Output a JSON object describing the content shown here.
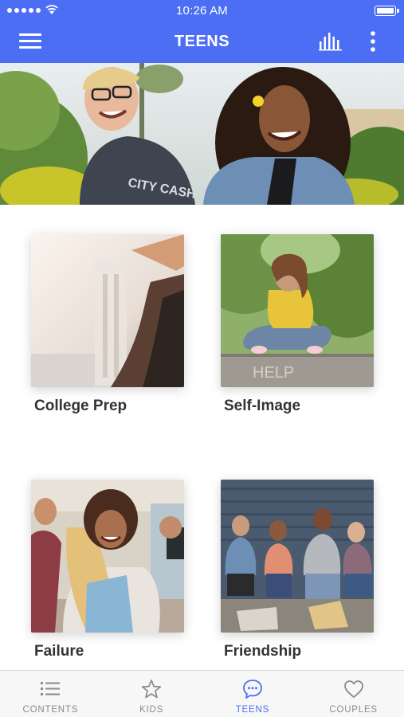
{
  "status_bar": {
    "time": "10:26 AM"
  },
  "header": {
    "title": "TEENS",
    "menu_icon": "hamburger-icon",
    "stats_icon": "bar-chart-icon",
    "more_icon": "more-vertical-icon"
  },
  "colors": {
    "primary": "#4c6ef5",
    "inactive": "#8a8a8a",
    "label": "#333333"
  },
  "hero": {
    "image": "two-smiling-teens-photo"
  },
  "topics": [
    {
      "label": "College Prep",
      "image": "graduation-cap-photo"
    },
    {
      "label": "Self-Image",
      "image": "girl-sitting-help-photo"
    },
    {
      "label": "Failure",
      "image": "friends-hug-hallway-photo"
    },
    {
      "label": "Friendship",
      "image": "group-of-teens-photo"
    }
  ],
  "tabs": [
    {
      "label": "CONTENTS",
      "icon": "list-icon",
      "active": false
    },
    {
      "label": "KIDS",
      "icon": "star-icon",
      "active": false
    },
    {
      "label": "TEENS",
      "icon": "chat-bubble-icon",
      "active": true
    },
    {
      "label": "COUPLES",
      "icon": "heart-icon",
      "active": false
    }
  ]
}
